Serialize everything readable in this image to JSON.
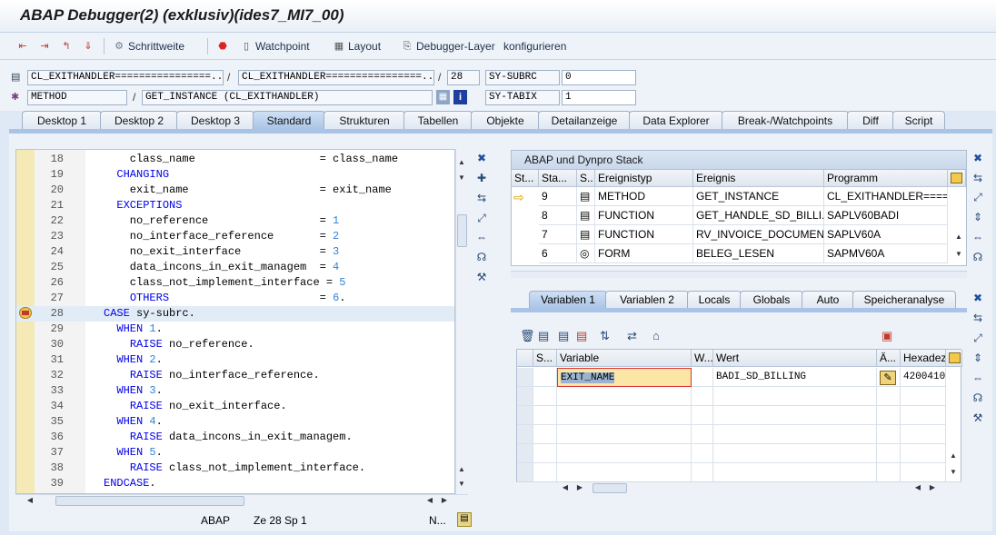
{
  "window": {
    "title": "ABAP Debugger(2)  (exklusiv)(ides7_MI7_00)"
  },
  "toolbar": {
    "step_icons": [
      "step-into-icon",
      "step-over-icon",
      "return-icon",
      "continue-icon"
    ],
    "schrittweite": "Schrittweite",
    "watchpoint": "Watchpoint",
    "layout": "Layout",
    "debugger_layer": "Debugger-Layer",
    "konfigurieren": "konfigurieren"
  },
  "context": {
    "program": "CL_EXITHANDLER================...",
    "include": "CL_EXITHANDLER================...",
    "line": "28",
    "type": "METHOD",
    "name": "GET_INSTANCE (CL_EXITHANDLER)",
    "sysvars": [
      {
        "name": "SY-SUBRC",
        "value": "0"
      },
      {
        "name": "SY-TABIX",
        "value": "1"
      }
    ]
  },
  "desktop_tabs": [
    "Desktop 1",
    "Desktop 2",
    "Desktop 3",
    "Standard",
    "Strukturen",
    "Tabellen",
    "Objekte",
    "Detailanzeige",
    "Data Explorer",
    "Break-/Watchpoints",
    "Diff",
    "Script"
  ],
  "active_desktop_tab": "Standard",
  "source": {
    "lines": [
      {
        "n": "18",
        "t": "    class_name                   = class_name"
      },
      {
        "n": "19",
        "t": "  CHANGING"
      },
      {
        "n": "20",
        "t": "    exit_name                    = exit_name"
      },
      {
        "n": "21",
        "t": "  EXCEPTIONS"
      },
      {
        "n": "22",
        "t": "    no_reference                 = 1"
      },
      {
        "n": "23",
        "t": "    no_interface_reference       = 2"
      },
      {
        "n": "24",
        "t": "    no_exit_interface            = 3"
      },
      {
        "n": "25",
        "t": "    data_incons_in_exit_managem  = 4"
      },
      {
        "n": "26",
        "t": "    class_not_implement_interface = 5"
      },
      {
        "n": "27",
        "t": "    OTHERS                       = 6."
      },
      {
        "n": "28",
        "t": "CASE sy-subrc."
      },
      {
        "n": "29",
        "t": "  WHEN 1."
      },
      {
        "n": "30",
        "t": "    RAISE no_reference."
      },
      {
        "n": "31",
        "t": "  WHEN 2."
      },
      {
        "n": "32",
        "t": "    RAISE no_interface_reference."
      },
      {
        "n": "33",
        "t": "  WHEN 3."
      },
      {
        "n": "34",
        "t": "    RAISE no_exit_interface."
      },
      {
        "n": "35",
        "t": "  WHEN 4."
      },
      {
        "n": "36",
        "t": "    RAISE data_incons_in_exit_managem."
      },
      {
        "n": "37",
        "t": "  WHEN 5."
      },
      {
        "n": "38",
        "t": "    RAISE class_not_implement_interface."
      },
      {
        "n": "39",
        "t": "ENDCASE."
      }
    ],
    "current_line": "28"
  },
  "status": {
    "lang": "ABAP",
    "pos": "Ze 28 Sp   1",
    "mode": "N..."
  },
  "stack": {
    "title": "ABAP und Dynpro Stack",
    "headers": [
      "St...",
      "Sta...",
      "S..",
      "Ereignistyp",
      "Ereignis",
      "Programm"
    ],
    "rows": [
      {
        "level": "9",
        "type": "METHOD",
        "event": "GET_INSTANCE",
        "program": "CL_EXITHANDLER====",
        "current": true
      },
      {
        "level": "8",
        "type": "FUNCTION",
        "event": "GET_HANDLE_SD_BILLI...",
        "program": "SAPLV60BADI"
      },
      {
        "level": "7",
        "type": "FUNCTION",
        "event": "RV_INVOICE_DOCUMEN...",
        "program": "SAPLV60A"
      },
      {
        "level": "6",
        "type": "FORM",
        "event": "BELEG_LESEN",
        "program": "SAPMV60A"
      }
    ]
  },
  "var_tabs": [
    "Variablen 1",
    "Variablen 2",
    "Locals",
    "Globals",
    "Auto",
    "Speicheranalyse"
  ],
  "active_var_tab": "Variablen 1",
  "variables": {
    "headers": [
      "S...",
      "Variable",
      "W...",
      "Wert",
      "Ä...",
      "Hexadez"
    ],
    "rows": [
      {
        "variable": "EXIT_NAME",
        "value": "BADI_SD_BILLING",
        "hex": "4200410"
      }
    ]
  }
}
